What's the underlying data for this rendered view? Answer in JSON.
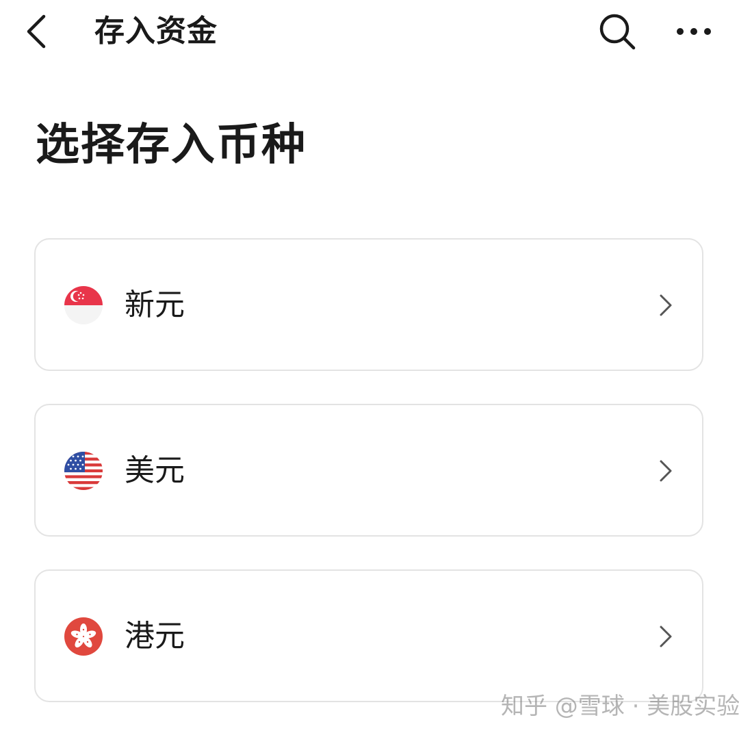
{
  "header": {
    "title": "存入资金",
    "back_icon": "chevron-left-icon",
    "search_icon": "search-icon",
    "more_icon": "more-dots-icon"
  },
  "section": {
    "title": "选择存入币种"
  },
  "currencies": [
    {
      "label": "新元",
      "flag": "singapore-flag-icon"
    },
    {
      "label": "美元",
      "flag": "usa-flag-icon"
    },
    {
      "label": "港元",
      "flag": "hong-kong-flag-icon"
    }
  ],
  "watermark": "知乎 @雪球 · 美股实验室",
  "colors": {
    "text": "#1a1a1a",
    "card_border": "#e3e3e3",
    "chevron": "#555555",
    "sg_red": "#e8354a",
    "us_red": "#d93a3a",
    "us_blue": "#2f4ea3",
    "hk_red": "#e0483e"
  }
}
